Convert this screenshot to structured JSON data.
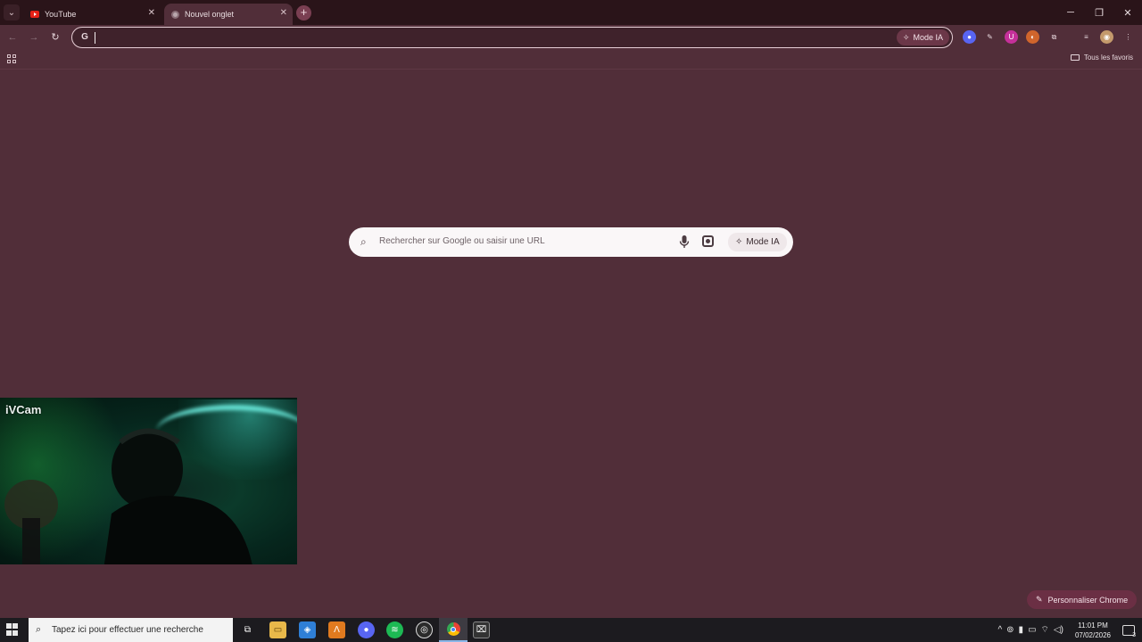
{
  "tabs": [
    {
      "label": "YouTube",
      "active": false
    },
    {
      "label": "Nouvel onglet",
      "active": true
    }
  ],
  "toolbar": {
    "omnibox_value": "",
    "omnibox_mode_label": "Mode IA",
    "bookmarks_all_label": "Tous les favoris"
  },
  "newtab": {
    "search_placeholder": "Rechercher sur Google ou saisir une URL",
    "mode_label": "Mode IA",
    "customize_label": "Personnaliser Chrome"
  },
  "webcam": {
    "label": "iVCam"
  },
  "taskbar": {
    "search_placeholder": "Tapez ici pour effectuer une recherche",
    "time": "11:01 PM",
    "date": "07/02/2026",
    "notification_count": "3"
  },
  "colors": {
    "page_background": "#512e39",
    "tabstrip": "#2a1419",
    "accent": "#6b2f44"
  }
}
